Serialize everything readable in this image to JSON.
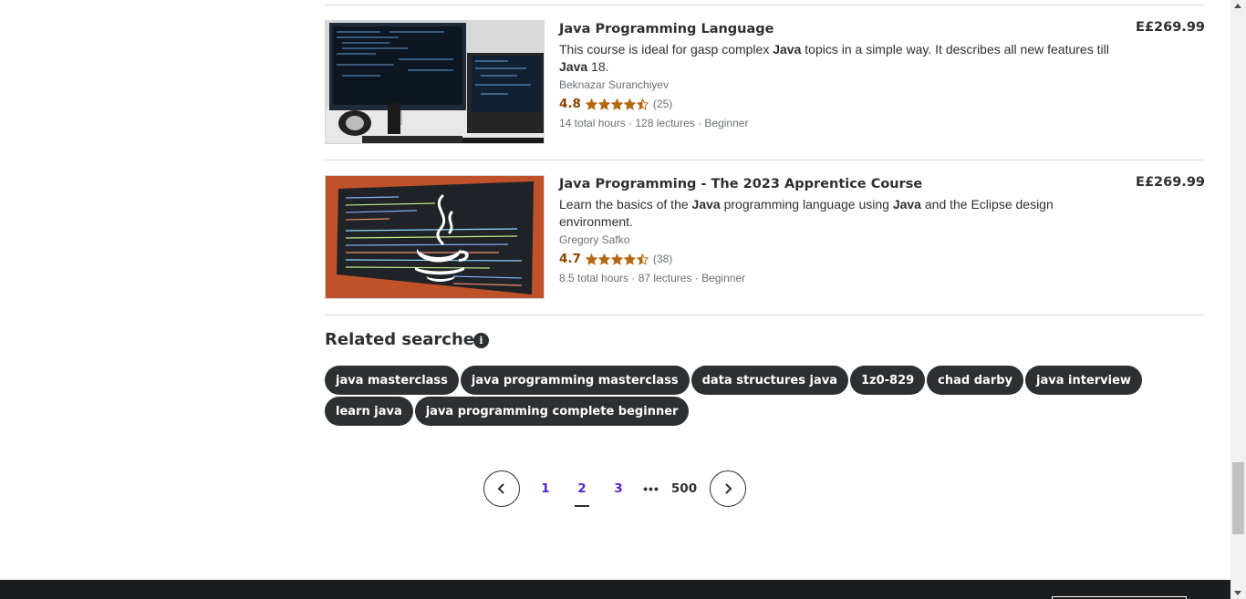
{
  "courses": [
    {
      "title": "Java Programming Language",
      "description_parts": [
        {
          "t": "This course is ideal for gasp complex ",
          "b": false
        },
        {
          "t": "Java",
          "b": true
        },
        {
          "t": " topics in a simple way. It describes all new features till ",
          "b": false
        },
        {
          "t": "Java",
          "b": true
        },
        {
          "t": " 18.",
          "b": false
        }
      ],
      "instructor": "Beknazar Suranchiyev",
      "rating": "4.8",
      "rating_stars": 4.8,
      "rating_count": "(25)",
      "meta": "14 total hours · 128 lectures · Beginner",
      "price": "E£269.99"
    },
    {
      "title": "Java Programming - The 2023 Apprentice Course",
      "description_parts": [
        {
          "t": "Learn the basics of the ",
          "b": false
        },
        {
          "t": "Java",
          "b": true
        },
        {
          "t": " programming language using ",
          "b": false
        },
        {
          "t": "Java",
          "b": true
        },
        {
          "t": " and the Eclipse design environment.",
          "b": false
        }
      ],
      "instructor": "Gregory Safko",
      "rating": "4.7",
      "rating_stars": 4.7,
      "rating_count": "(38)",
      "meta": "8.5 total hours · 87 lectures · Beginner",
      "price": "E£269.99"
    }
  ],
  "related": {
    "title": "Related searches",
    "chips": [
      "java masterclass",
      "java programming masterclass",
      "data structures java",
      "1z0-829",
      "chad darby",
      "java interview",
      "learn java",
      "java programming complete beginner"
    ]
  },
  "pagination": {
    "pages": [
      "1",
      "2",
      "3"
    ],
    "current": "2",
    "ellipsis": "•••",
    "last": "500"
  },
  "colors": {
    "rating": "#8c4300",
    "star": "#b4690e",
    "link": "#5624d0",
    "chip_bg": "#2d2f31",
    "footer": "#1c1d1f"
  }
}
